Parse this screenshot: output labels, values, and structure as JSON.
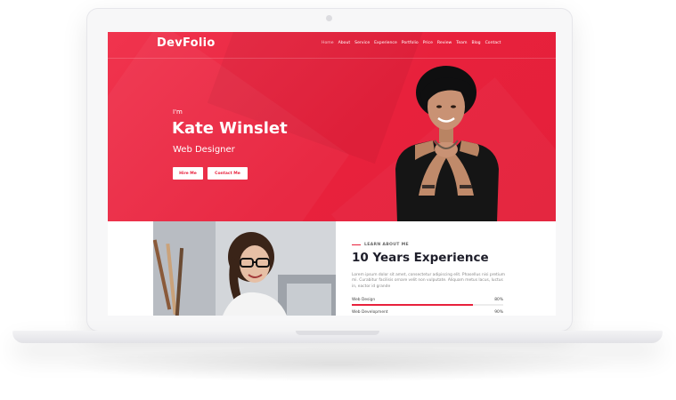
{
  "site": {
    "logo": "DevFolio",
    "nav": [
      "Home",
      "About",
      "Service",
      "Experience",
      "Portfolio",
      "Price",
      "Review",
      "Team",
      "Blog",
      "Contact"
    ],
    "active_nav": "Home"
  },
  "hero": {
    "greeting": "I'm",
    "name": "Kate Winslet",
    "role": "Web Designer",
    "hire_button": "Hire Me",
    "contact_button": "Contact Me"
  },
  "about": {
    "eyebrow": "LEARN ABOUT ME",
    "title": "10 Years Experience",
    "text": "Lorem ipsum dolor sit amet, consectetur adipiscing elit. Phasellus nisi pretium mi. Curabitur facilisis ornare velit non vulputate. Aliquam metus lacus, luctus in, eactor id grande",
    "skills": [
      {
        "label": "Web Design",
        "percent": "80%",
        "level": 0.8
      },
      {
        "label": "Web Development",
        "percent": "90%",
        "level": 0.9
      }
    ]
  },
  "colors": {
    "accent": "#e8213c",
    "heading": "#1e1e2a"
  }
}
